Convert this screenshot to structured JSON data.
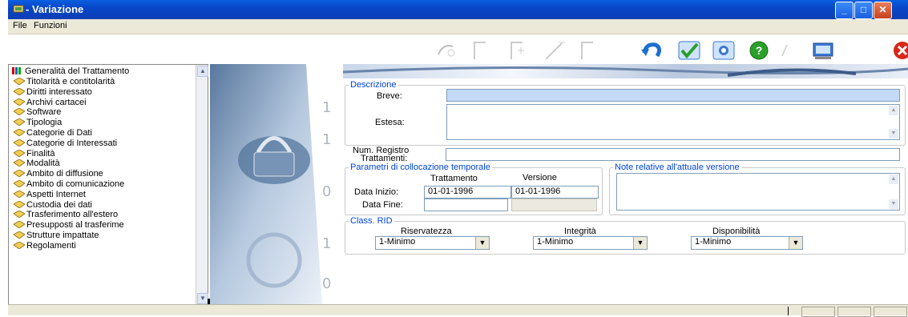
{
  "window": {
    "title": "- Variazione",
    "accent": "#0a4fd5"
  },
  "menu": {
    "file": "File",
    "funzioni": "Funzioni"
  },
  "tree": {
    "root": "Generalità del Trattamento",
    "items": [
      "Titolarità e contitolarità",
      "Diritti interessato",
      "Archivi cartacei",
      "Software",
      "Tipologia",
      "Categorie di Dati",
      "Categorie di Interessati",
      "Finalità",
      "Modalità",
      "Ambito di diffusione",
      "Ambito di comunicazione",
      "Aspetti Internet",
      "Custodia dei dati",
      "Trasferimento all'estero",
      "Presupposti al trasferime",
      "Strutture impattate",
      "Regolamenti"
    ]
  },
  "form": {
    "descrizione": {
      "legend": "Descrizione",
      "breve_label": "Breve:",
      "estesa_label": "Estesa:"
    },
    "registro": {
      "label_line1": "Num. Registro",
      "label_line2": "Trattamenti:"
    },
    "parametri": {
      "legend": "Parametri di collocazione temporale",
      "col_trattamento": "Trattamento",
      "col_versione": "Versione",
      "data_inizio_label": "Data Inizio:",
      "data_fine_label": "Data Fine:",
      "inizio_trattamento": "01-01-1996",
      "inizio_versione": "01-01-1996"
    },
    "note": {
      "legend": "Note relative all'attuale versione"
    },
    "rid": {
      "legend": "Class. RID",
      "riservatezza_label": "Riservatezza",
      "integrita_label": "Integrità",
      "disponibilita_label": "Disponibilità",
      "riservatezza_value": "1-Minimo",
      "integrita_value": "1-Minimo",
      "disponibilita_value": "1-Minimo"
    }
  },
  "image_text": {
    "d1": "1",
    "d2": "0"
  }
}
